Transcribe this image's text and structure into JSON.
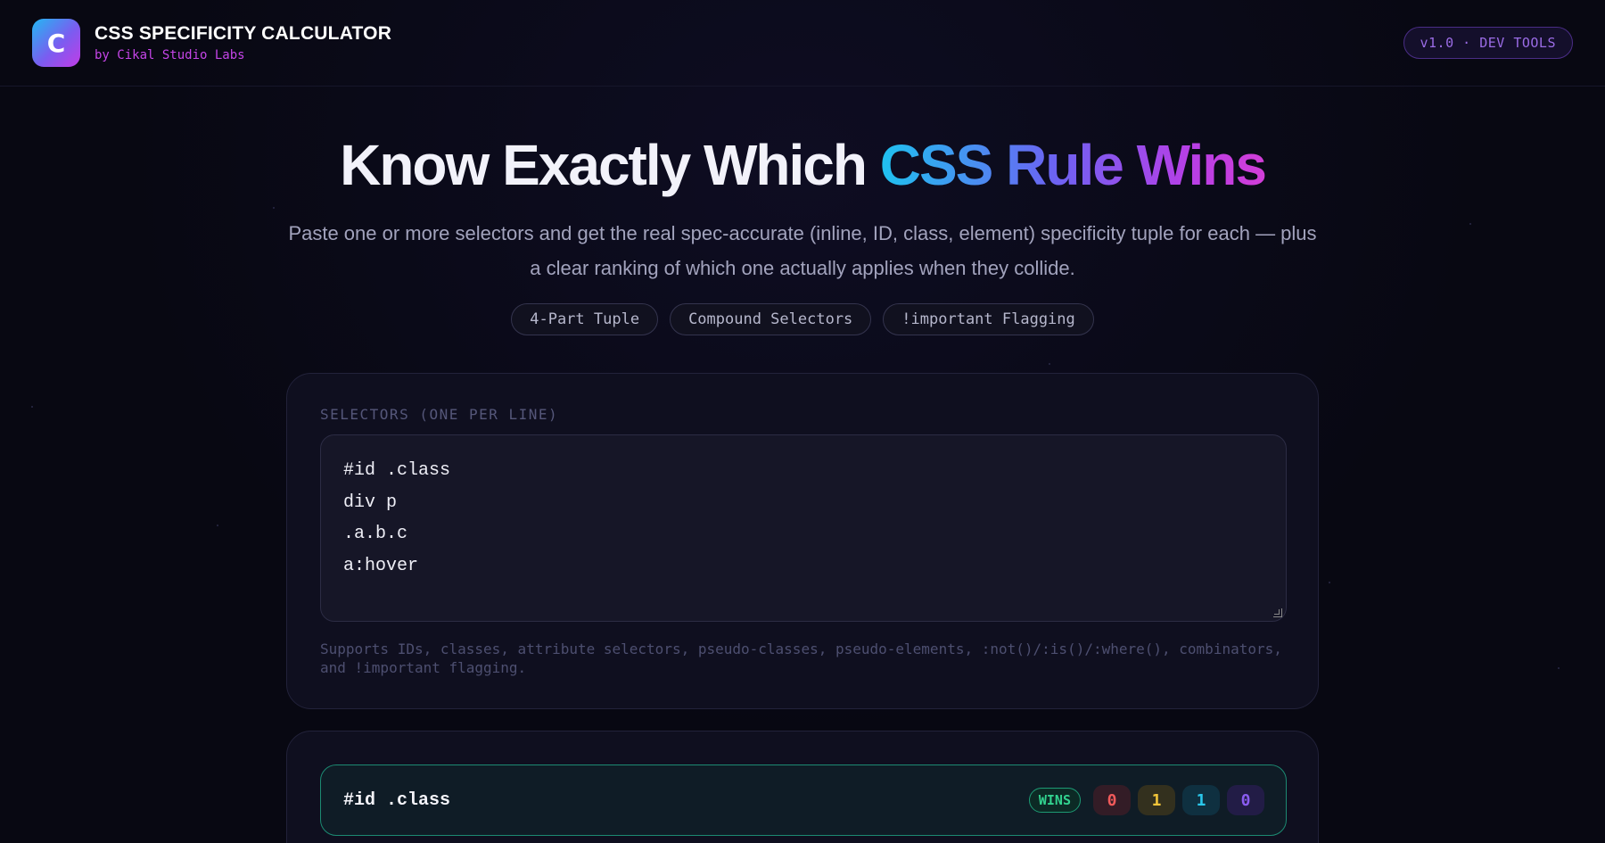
{
  "header": {
    "logo_letter": "C",
    "title": "CSS SPECIFICITY CALCULATOR",
    "subtitle": "by Cikal Studio Labs",
    "version": "v1.0 · DEV TOOLS"
  },
  "hero": {
    "title_plain": "Know Exactly Which ",
    "title_gradient": "CSS Rule Wins",
    "description": "Paste one or more selectors and get the real spec-accurate (inline, ID, class, element) specificity tuple for each — plus a clear ranking of which one actually applies when they collide.",
    "tags": [
      "4-Part Tuple",
      "Compound Selectors",
      "!important Flagging"
    ]
  },
  "input": {
    "label": "SELECTORS (ONE PER LINE)",
    "lines": [
      "#id .class",
      "div p",
      ".a.b.c",
      "a:hover"
    ],
    "hint": "Supports IDs, classes, attribute selectors, pseudo-classes, pseudo-elements, :not()/:is()/:where(), combinators, and !important flagging."
  },
  "results": [
    {
      "selector": "#id .class",
      "badge": "WINS",
      "tuple": [
        "0",
        "1",
        "1",
        "0"
      ]
    }
  ],
  "colors": {
    "accent_cyan": "#1fc2f0",
    "accent_violet": "#6c63f2",
    "accent_magenta": "#d23ed8",
    "win_green": "#32d38f",
    "inline_red": "#f05a5a",
    "id_yellow": "#f2c53a",
    "class_cyan": "#2ac8ec",
    "element_purple": "#8a5cf0"
  }
}
